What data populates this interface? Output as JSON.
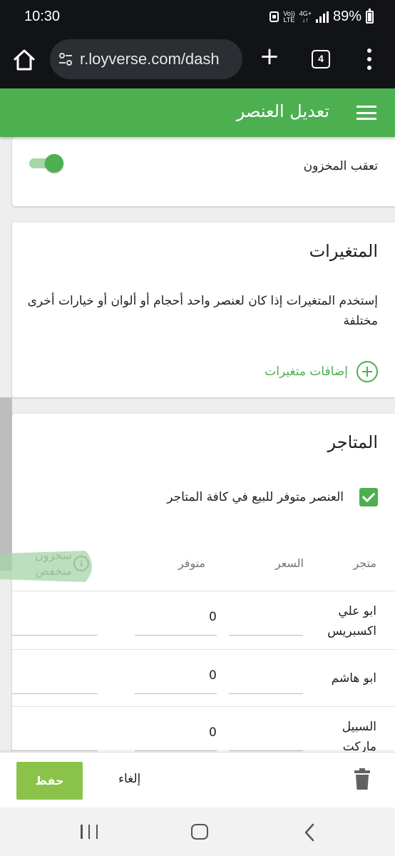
{
  "status_bar": {
    "time": "10:30",
    "volte_top": "Vo))",
    "volte_bottom": "LTE",
    "network_top": "4G+",
    "network_bottom": "↓↑",
    "battery": "89%"
  },
  "browser": {
    "url": "r.loyverse.com/dash",
    "tab_count": "4"
  },
  "header": {
    "title": "تعديل العنصر"
  },
  "inventory": {
    "track_stock_label": "تعقب المخزون",
    "track_stock_on": true
  },
  "variants": {
    "title": "المتغيرات",
    "description": "إستخدم المتغيرات إذا كان لعنصر واحد أحجام أو ألوان أو خيارات أخرى مختلفة",
    "add_label": "إضافات متغيرات"
  },
  "stores": {
    "title": "المتاجر",
    "available_all_label": "العنصر متوفر للبيع في كافة المتاجر",
    "available_all_checked": true,
    "columns": {
      "store": "متجر",
      "price": "السعر",
      "available": "متوفر",
      "low_stock": "سحزون منخفض"
    },
    "rows": [
      {
        "store": "ابو علي اكسبريس",
        "price": "",
        "available": "0",
        "low_stock": ""
      },
      {
        "store": "ابو هاشم",
        "price": "",
        "available": "0",
        "low_stock": ""
      },
      {
        "store": "السبيل ماركت",
        "price": "",
        "available": "0",
        "low_stock": ""
      }
    ]
  },
  "actions": {
    "save": "حفظ",
    "cancel": "إلغاء"
  },
  "colors": {
    "primary": "#4caf50",
    "save_button": "#8bc34a",
    "status_bar": "#111316"
  }
}
